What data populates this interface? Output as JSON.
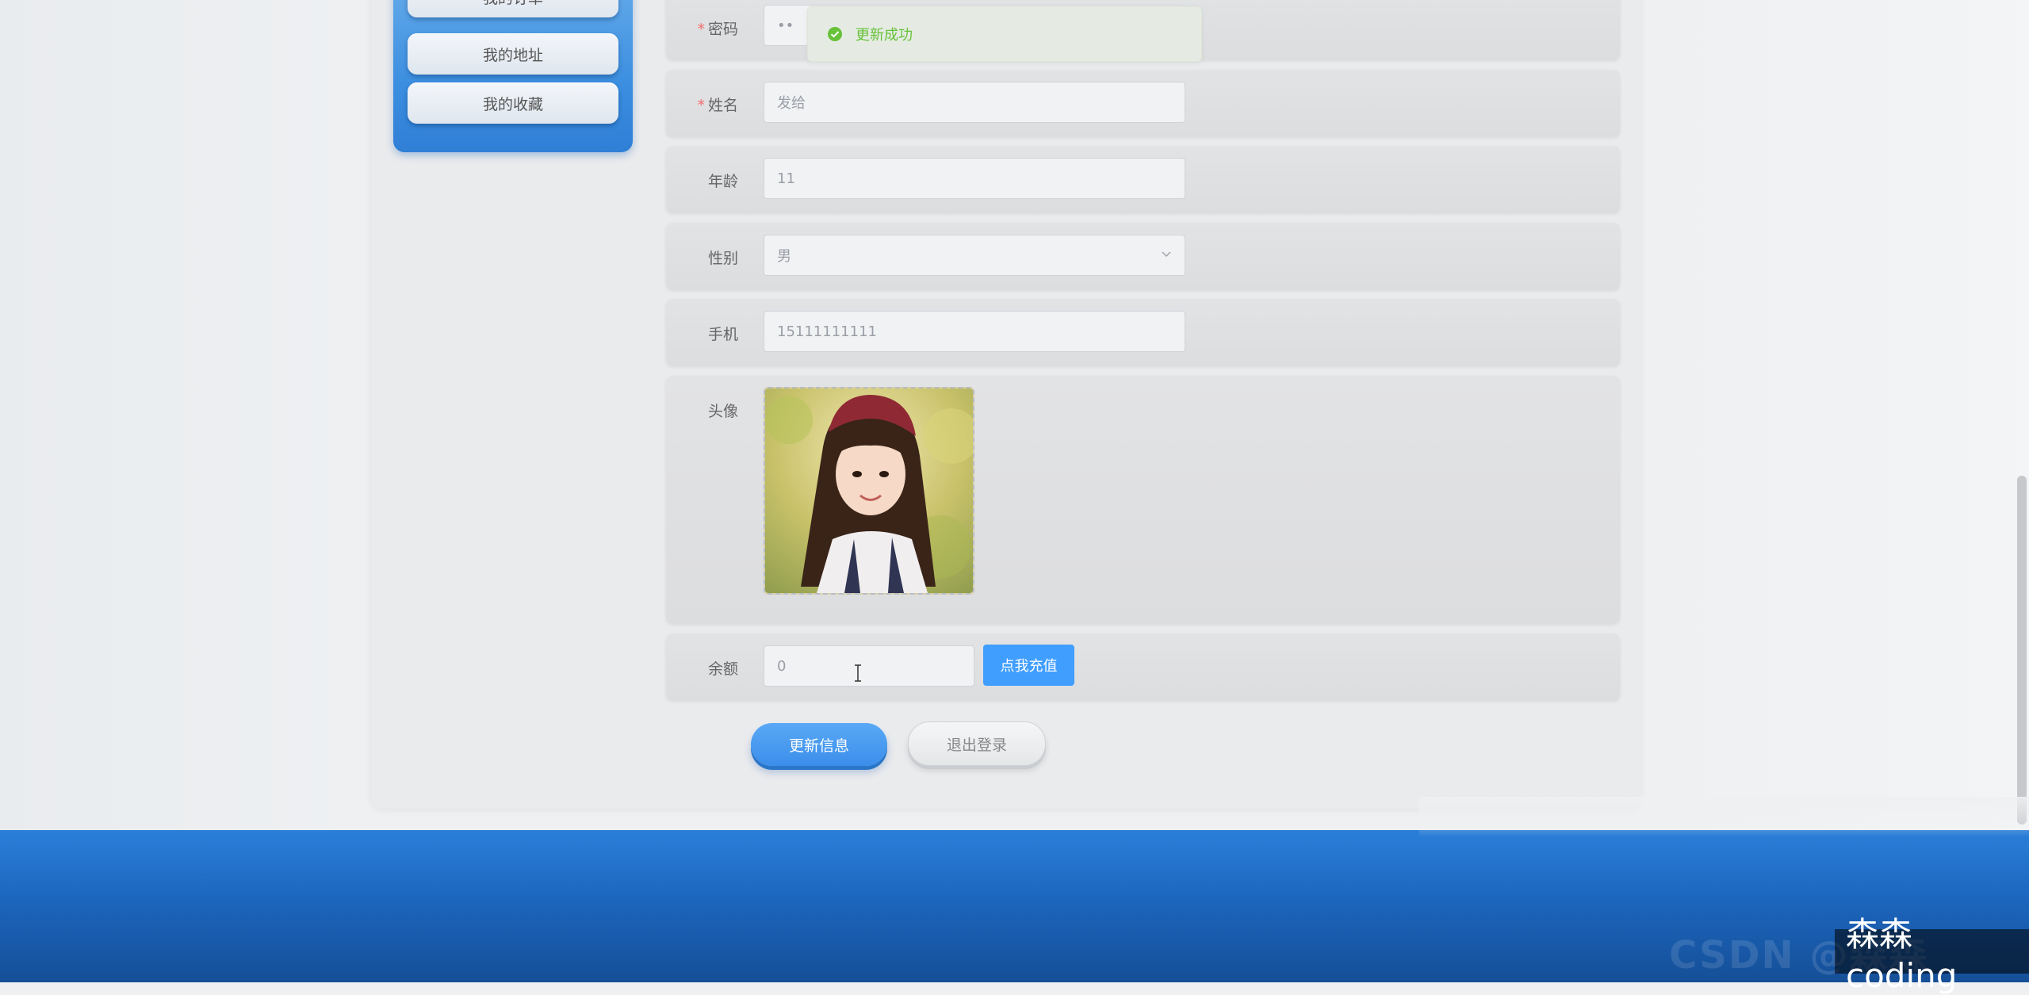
{
  "sidebar": {
    "items": [
      {
        "label": "我的订单"
      },
      {
        "label": "我的地址"
      },
      {
        "label": "我的收藏"
      }
    ]
  },
  "toast": {
    "message": "更新成功",
    "color": "#67c23a"
  },
  "form": {
    "password": {
      "label": "密码",
      "value": "••"
    },
    "name": {
      "label": "姓名",
      "value": "发给"
    },
    "age": {
      "label": "年龄",
      "value": "11"
    },
    "gender": {
      "label": "性别",
      "value": "男"
    },
    "phone": {
      "label": "手机",
      "value": "15111111111"
    },
    "avatar": {
      "label": "头像"
    },
    "balance": {
      "label": "余额",
      "value": "0",
      "recharge_label": "点我充值"
    }
  },
  "actions": {
    "update_label": "更新信息",
    "logout_label": "退出登录"
  },
  "watermark": {
    "text": "森森coding",
    "faint_text": "CSDN @森森"
  },
  "colors": {
    "primary": "#409eff",
    "footer": "#1c66be"
  }
}
